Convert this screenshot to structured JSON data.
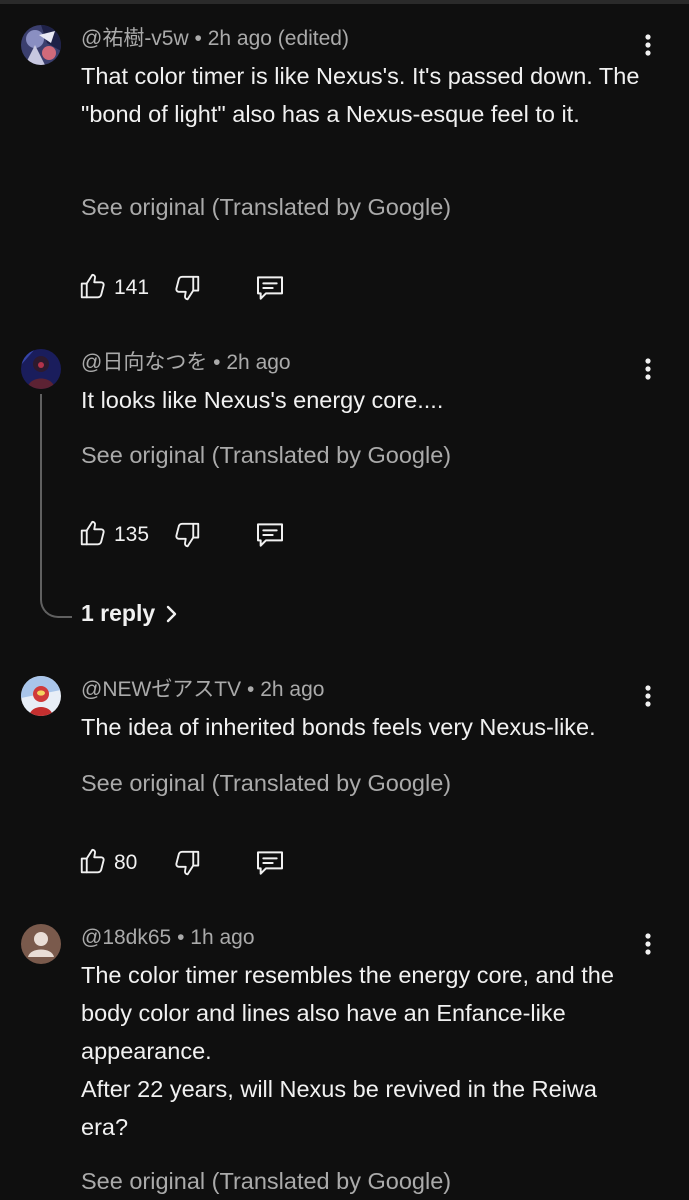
{
  "comments": [
    {
      "author": "@祐樹-v5w",
      "separator": "•",
      "time": "2h ago",
      "edited": "(edited)",
      "text": "That color timer is like Nexus's. It's passed down. The \"bond of light\" also has a Nexus-esque feel to it.",
      "see_original": "See original (Translated by Google)",
      "likes": "141",
      "avatar_icon": "anime-character-avatar"
    },
    {
      "author": "@日向なつを",
      "separator": "•",
      "time": "2h ago",
      "text": "It looks like Nexus's energy core....",
      "see_original": "See original (Translated by Google)",
      "likes": "135",
      "replies": "1 reply",
      "avatar_icon": "dark-figure-avatar"
    },
    {
      "author": "@NEWゼアスTV",
      "separator": "•",
      "time": "2h ago",
      "text": "The idea of inherited bonds feels very Nexus-like.",
      "see_original": "See original (Translated by Google)",
      "likes": "80",
      "avatar_icon": "hero-avatar"
    },
    {
      "author": "@18dk65",
      "separator": "•",
      "time": "1h ago",
      "text": "The color timer resembles the energy core, and the body color and lines also have an Enfance-like appearance.",
      "text2": "After 22 years, will Nexus be revived in the Reiwa era?",
      "see_original": "See original (Translated by Google)",
      "avatar_icon": "default-person-avatar"
    }
  ],
  "colors": {
    "background": "#0f0f0f",
    "primary_text": "#f1f1f1",
    "secondary_text": "#aaaaaa",
    "thread_line": "#606060"
  }
}
